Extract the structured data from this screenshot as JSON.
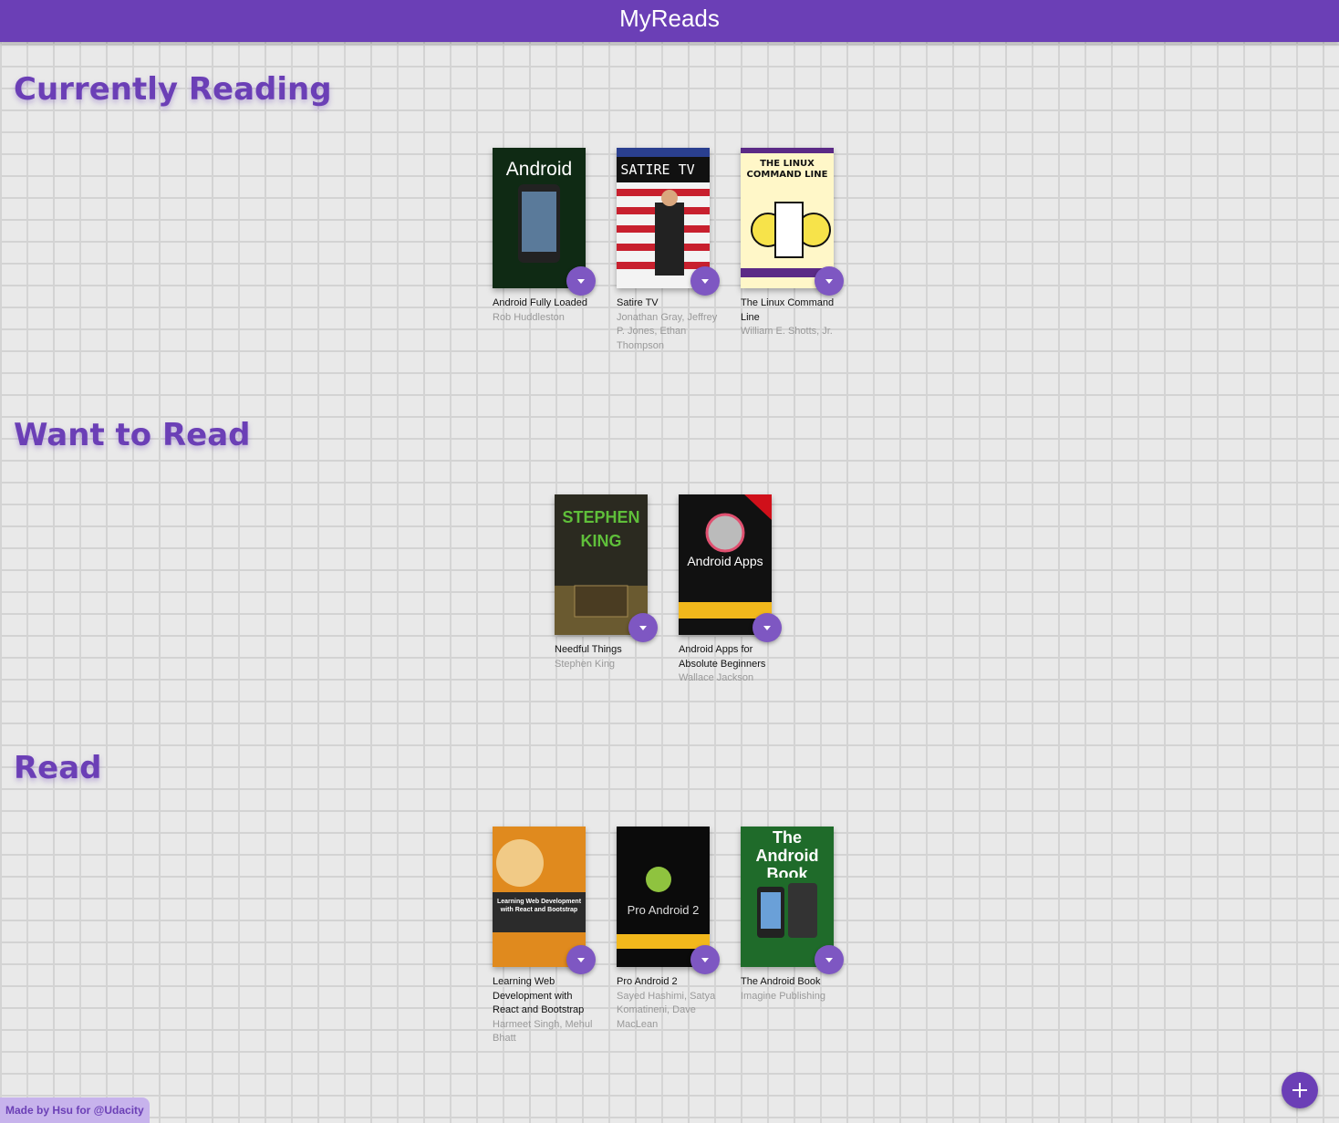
{
  "app": {
    "title": "MyReads"
  },
  "shelves": [
    {
      "title": "Currently Reading",
      "books": [
        {
          "title": "Android Fully Loaded",
          "authors": "Rob Huddleston",
          "cover_text": "Android"
        },
        {
          "title": "Satire TV",
          "authors": "Jonathan Gray, Jeffrey P. Jones, Ethan Thompson",
          "cover_text": "SATIRE TV"
        },
        {
          "title": "The Linux Command Line",
          "authors": "William E. Shotts, Jr.",
          "cover_text": "THE LINUX COMMAND LINE"
        }
      ]
    },
    {
      "title": "Want to Read",
      "books": [
        {
          "title": "Needful Things",
          "authors": "Stephen King",
          "cover_text": "STEPHEN KING"
        },
        {
          "title": "Android Apps for Absolute Beginners",
          "authors": "Wallace Jackson",
          "cover_text": "Android Apps"
        }
      ]
    },
    {
      "title": "Read",
      "books": [
        {
          "title": "Learning Web Development with React and Bootstrap",
          "authors": "Harmeet Singh, Mehul Bhatt",
          "cover_text": "Learning Web Development with React and Bootstrap"
        },
        {
          "title": "Pro Android 2",
          "authors": "Sayed Hashimi, Satya Komatineni, Dave MacLean",
          "cover_text": "Pro Android 2"
        },
        {
          "title": "The Android Book",
          "authors": "Imagine Publishing",
          "cover_text": "The Android Book"
        }
      ]
    }
  ],
  "footer": {
    "credit": "Made by Hsu for @Udacity"
  },
  "add_button": {
    "icon": "plus-icon"
  }
}
